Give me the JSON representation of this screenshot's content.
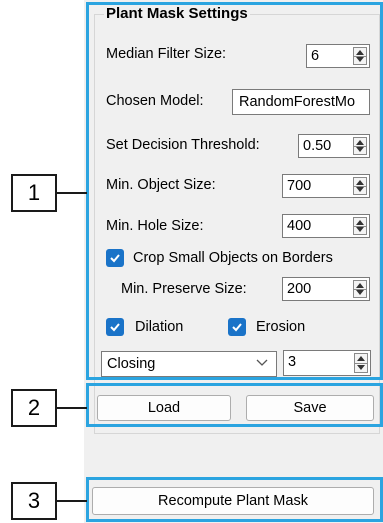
{
  "group_title": "Plant Mask Settings",
  "fields": {
    "median_filter": {
      "label": "Median Filter Size:",
      "value": "6"
    },
    "chosen_model": {
      "label": "Chosen Model:",
      "value": "RandomForestMo"
    },
    "decision_threshold": {
      "label": "Set Decision Threshold:",
      "value": "0.50"
    },
    "min_object_size": {
      "label": "Min. Object Size:",
      "value": "700"
    },
    "min_hole_size": {
      "label": "Min. Hole Size:",
      "value": "400"
    },
    "crop_small_objects": {
      "label": "Crop Small Objects on Borders",
      "checked": true
    },
    "min_preserve_size": {
      "label": "Min. Preserve Size:",
      "value": "200"
    },
    "dilation": {
      "label": "Dilation",
      "checked": true
    },
    "erosion": {
      "label": "Erosion",
      "checked": true
    },
    "morph_operation": {
      "value": "Closing"
    },
    "morph_iterations": {
      "value": "3"
    }
  },
  "buttons": {
    "load": "Load",
    "save": "Save",
    "recompute": "Recompute Plant Mask"
  },
  "callouts": [
    "1",
    "2",
    "3"
  ],
  "colors": {
    "highlight": "#2ba4e0",
    "checkbox": "#1a73c8",
    "panel": "#f0f0f0"
  }
}
